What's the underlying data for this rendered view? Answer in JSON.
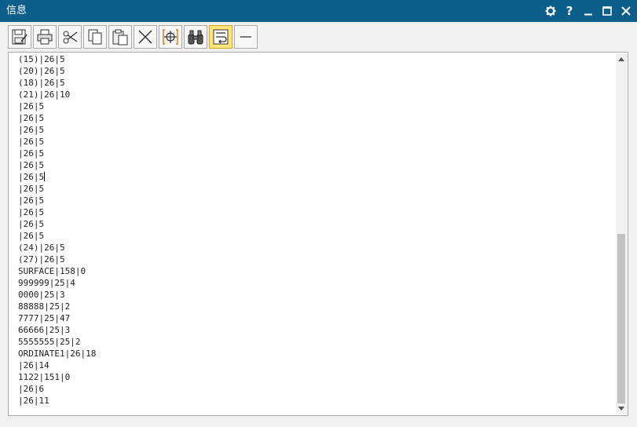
{
  "window": {
    "title": "信息",
    "controls": [
      "gear-icon",
      "help-icon",
      "minimize-icon",
      "maximize-icon",
      "close-icon"
    ],
    "title_bar_color": "#0b5d8a",
    "help_label": "?"
  },
  "toolbar": {
    "buttons": [
      {
        "icon": "save-icon"
      },
      {
        "icon": "print-icon"
      },
      {
        "icon": "cut-icon"
      },
      {
        "icon": "copy-icon"
      },
      {
        "icon": "paste-icon"
      },
      {
        "icon": "clear-icon"
      },
      {
        "icon": "select-point-icon"
      },
      {
        "icon": "find-icon"
      },
      {
        "icon": "word-wrap-icon",
        "active": true
      },
      {
        "icon": "separator-line-icon"
      }
    ],
    "active_color": "#ffe57a"
  },
  "content": {
    "lines": [
      "(15)|26|5",
      "(20)|26|5",
      "(18)|26|5",
      "(21)|26|10",
      "|26|5",
      "|26|5",
      "|26|5",
      "|26|5",
      "|26|5",
      "|26|5",
      "|26|5",
      "|26|5",
      "|26|5",
      "|26|5",
      "|26|5",
      "|26|5",
      "(24)|26|5",
      "(27)|26|5",
      "SURFACE|158|0",
      "999999|25|4",
      "0000|25|3",
      "88888|25|2",
      "7777|25|47",
      "66666|25|3",
      "5555555|25|2",
      "ORDINATE1|26|18",
      "|26|14",
      "1122|151|0",
      "|26|6",
      "|26|11"
    ],
    "caret_line": 10
  },
  "scrollbar": {
    "position_fraction": 0.5,
    "visible_fraction": 0.5
  }
}
